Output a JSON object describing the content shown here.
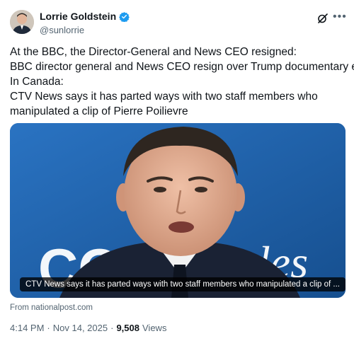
{
  "author": {
    "name": "Lorrie Goldstein",
    "handle": "@sunlorrie"
  },
  "tweet": {
    "lines": [
      "At the BBC, the Director-General and News CEO resigned:",
      "BBC director general and News CEO resign over Trump documentary edit",
      "In Canada:",
      "CTV News says it has parted ways with two staff members who",
      "manipulated a clip of Pierre Poilievre"
    ]
  },
  "card": {
    "caption": "CTV News says it has parted ways with two staff members who manipulated a clip of ...",
    "background_text": "COU     les"
  },
  "source": "From nationalpost.com",
  "meta": {
    "time": "4:14 PM",
    "date": "Nov 14, 2025",
    "sep": "·",
    "views_count": "9,508",
    "views_label": "Views"
  },
  "colors": {
    "verified": "#1d9bf0",
    "card_bg": "#1d5fa6",
    "muted": "#536471"
  },
  "icons": {
    "grok": "grok-icon",
    "more": "more-icon",
    "verified": "verified-badge-icon"
  }
}
